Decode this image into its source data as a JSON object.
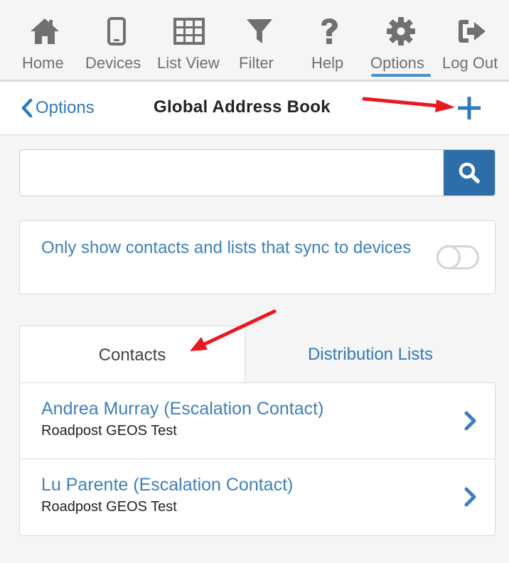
{
  "nav": {
    "items": [
      {
        "label": "Home",
        "icon": "home-icon"
      },
      {
        "label": "Devices",
        "icon": "phone-icon"
      },
      {
        "label": "List View",
        "icon": "grid-icon"
      },
      {
        "label": "Filter",
        "icon": "filter-icon"
      },
      {
        "label": "Help",
        "icon": "question-icon"
      },
      {
        "label": "Options",
        "icon": "gear-icon",
        "active": true
      },
      {
        "label": "Log Out",
        "icon": "logout-icon"
      }
    ]
  },
  "header": {
    "back_label": "Options",
    "title": "Global Address Book",
    "add_icon": "plus-icon"
  },
  "search": {
    "value": "",
    "placeholder": "",
    "button_icon": "search-icon"
  },
  "sync_filter": {
    "label": "Only show contacts and lists that sync to devices",
    "enabled": false
  },
  "tabs": [
    {
      "label": "Contacts",
      "active": true
    },
    {
      "label": "Distribution Lists",
      "active": false
    }
  ],
  "contacts": [
    {
      "name": "Andrea Murray (Escalation Contact)",
      "organization": "Roadpost GEOS Test"
    },
    {
      "name": "Lu Parente (Escalation Contact)",
      "organization": "Roadpost GEOS Test"
    }
  ],
  "colors": {
    "accent": "#337ab7",
    "icon_gray": "#707070",
    "search_button": "#2c6fa8",
    "annotation_arrow": "#e8191f"
  }
}
